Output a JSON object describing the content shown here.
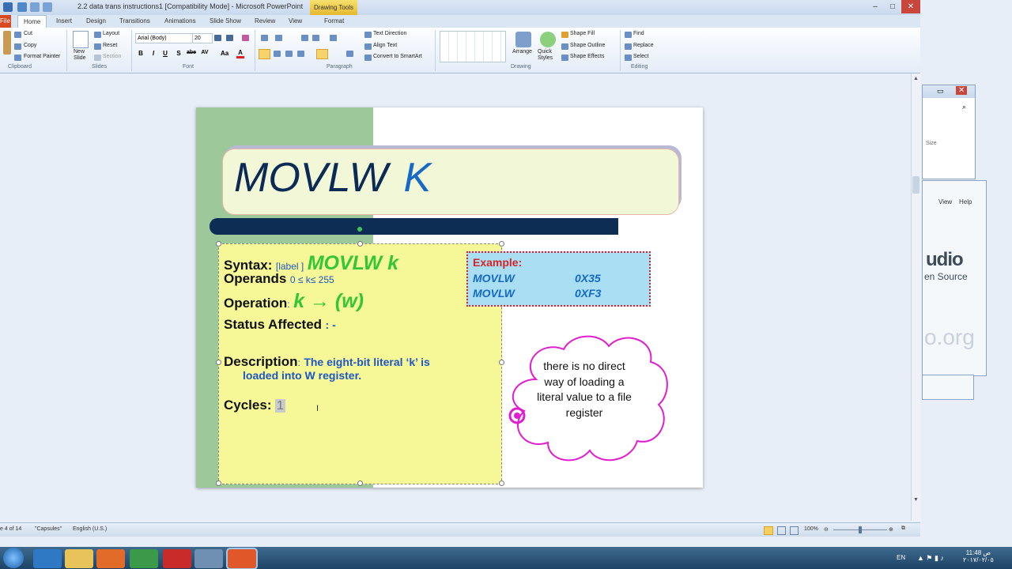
{
  "window": {
    "title": "2.2 data trans instructions1 [Compatibility Mode] - Microsoft PowerPoint",
    "context_tab": "Drawing Tools",
    "minimize": "–",
    "maximize": "□",
    "close": "✕"
  },
  "tabs": [
    "File",
    "Home",
    "Insert",
    "Design",
    "Transitions",
    "Animations",
    "Slide Show",
    "Review",
    "View",
    "Format"
  ],
  "ribbon": {
    "clipboard": {
      "paste": "",
      "cut": "Cut",
      "copy": "Copy",
      "format_painter": "Format Painter",
      "group": "Clipboard"
    },
    "slides": {
      "new_slide": "New Slide",
      "layout": "Layout",
      "reset": "Reset",
      "section": "Section",
      "group": "Slides"
    },
    "font": {
      "family": "Arial (Body)",
      "size": "20",
      "bold": "B",
      "italic": "I",
      "underline": "U",
      "strike": "S",
      "shadow": "abe",
      "spacing": "AV",
      "case": "Aa",
      "color": "A",
      "group": "Font"
    },
    "paragraph": {
      "text_direction": "Text Direction",
      "align_text": "Align Text",
      "smartart": "Convert to SmartArt",
      "group": "Paragraph"
    },
    "drawing": {
      "arrange": "Arrange",
      "quick_styles": "Quick Styles",
      "shape_fill": "Shape Fill",
      "shape_outline": "Shape Outline",
      "shape_effects": "Shape Effects",
      "group": "Drawing"
    },
    "editing": {
      "find": "Find",
      "replace": "Replace",
      "select": "Select",
      "group": "Editing"
    }
  },
  "slide": {
    "title_main": "MOVLW",
    "title_k": "K",
    "syntax_label": "Syntax:",
    "syntax_small": "[label ]",
    "syntax_cmd": "MOVLW  k",
    "operands_label": "Operands",
    "operands_range": "0 ≤ k≤ 255",
    "operation_label": "Operation",
    "operation_colon": ":",
    "operation_expr": "k → (w)",
    "status_label": "Status Affected",
    "status_value": ":  -",
    "description_label": "Description",
    "description_colon": ":",
    "description_line1": "The eight-bit literal ‘k’ is",
    "description_line2": "loaded into W register.",
    "cycles_label": "Cycles:",
    "cycles_value": "1",
    "example": {
      "label": "Example:",
      "rows": [
        {
          "op": "MOVLW",
          "arg": "0X35"
        },
        {
          "op": "MOVLW",
          "arg": "0XF3"
        }
      ]
    },
    "cloud_note": "there is no direct way of loading a literal value to a file register"
  },
  "side_windows": {
    "size_label": "Size",
    "menu_view": "View",
    "menu_help": "Help",
    "brand_line1": "udio",
    "brand_line2": "en Source",
    "domain": "o.org"
  },
  "status": {
    "slide_of": "e 4 of 14",
    "theme": "\"Capsules\"",
    "language": "English (U.S.)",
    "zoom": "100%"
  },
  "taskbar": {
    "language": "EN",
    "time": "11:48 ص",
    "date": "٢٠١٧/٠٢/٠٥"
  },
  "colors": {
    "accent_green": "#33c733",
    "accent_blue": "#1f56c4",
    "example_red": "#d3252b",
    "cloud_magenta": "#e01ed0"
  }
}
